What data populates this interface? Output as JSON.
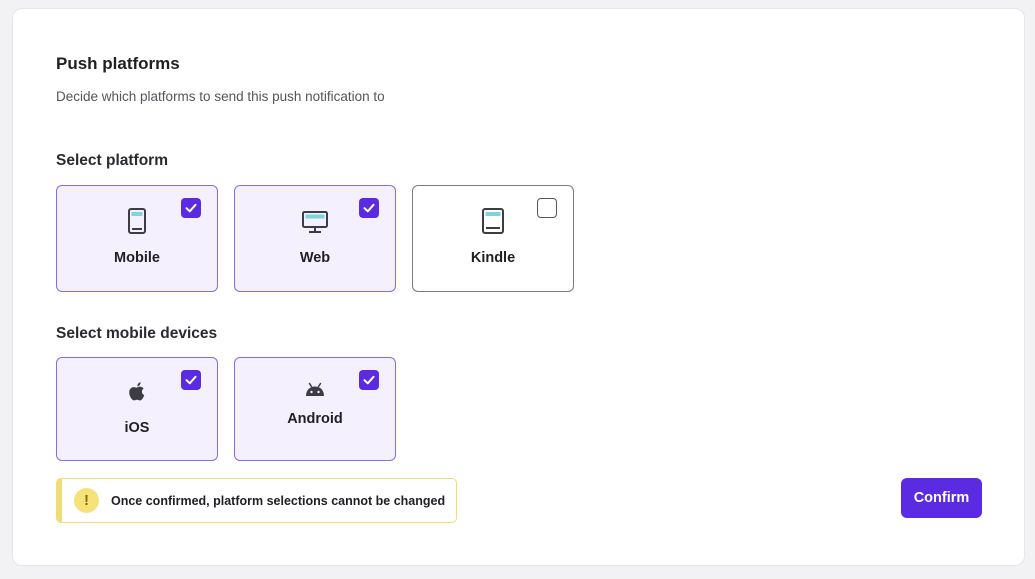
{
  "header": {
    "title": "Push platforms",
    "subtitle": "Decide which platforms to send this push notification to"
  },
  "platforms": {
    "label": "Select platform",
    "items": [
      {
        "label": "Mobile",
        "icon": "mobile-phone-icon",
        "checked": true
      },
      {
        "label": "Web",
        "icon": "desktop-monitor-icon",
        "checked": true
      },
      {
        "label": "Kindle",
        "icon": "kindle-tablet-icon",
        "checked": false
      }
    ]
  },
  "devices": {
    "label": "Select mobile devices",
    "items": [
      {
        "label": "iOS",
        "icon": "apple-icon",
        "checked": true
      },
      {
        "label": "Android",
        "icon": "android-icon",
        "checked": true
      }
    ]
  },
  "warning": {
    "icon": "exclamation-icon",
    "text": "Once confirmed, platform selections cannot be changed"
  },
  "actions": {
    "confirm_label": "Confirm"
  },
  "colors": {
    "accent": "#5a2be0",
    "selected_bg": "#f4f0fd",
    "warning": "#f1dc7a"
  }
}
